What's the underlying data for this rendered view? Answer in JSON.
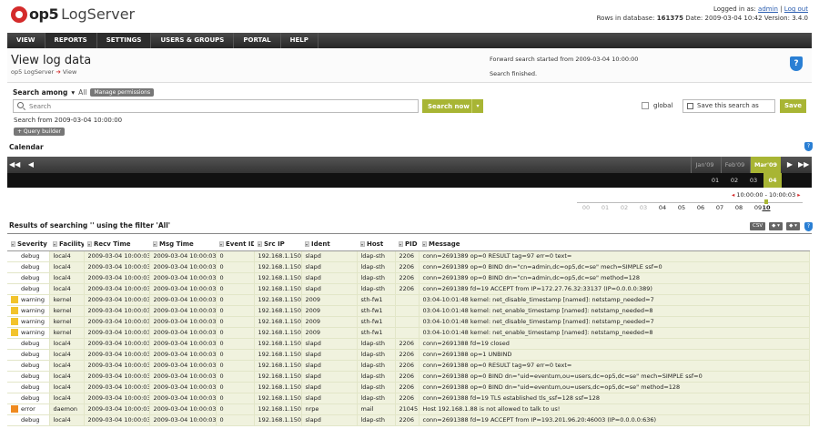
{
  "header": {
    "brand": "op5",
    "product": "LogServer",
    "logged_in_label": "Logged in as:",
    "user": "admin",
    "separator": "|",
    "logout": "Log out",
    "rows_label": "Rows in database:",
    "rows_value": "161375",
    "date_label": "Date:",
    "date_value": "2009-03-04 10:42",
    "version_label": "Version:",
    "version_value": "3.4.0"
  },
  "nav": [
    "VIEW",
    "REPORTS",
    "SETTINGS",
    "USERS & GROUPS",
    "PORTAL",
    "HELP"
  ],
  "page": {
    "title": "View log data",
    "crumb_root": "op5 LogServer",
    "crumb_arrow": "➔",
    "crumb_leaf": "View",
    "status_lines": [
      "Forward search started from 2009-03-04 10:00:00",
      "Search finished."
    ],
    "help_glyph": "?"
  },
  "search": {
    "among_label": "Search among",
    "among_caret": "▾",
    "among_value": "All",
    "manage_permissions": "Manage permissions",
    "placeholder": "Search",
    "search_now": "Search now",
    "dropdown_caret": "▾",
    "from_text": "Search from 2009-03-04 10:00:00",
    "query_builder": "+ Query builder",
    "global_label": "global",
    "save_as_label": "Save this search as",
    "save_button": "Save"
  },
  "calendar": {
    "title": "Calendar",
    "help_glyph": "?",
    "nav_first": "◀◀",
    "nav_prev": "◀",
    "nav_next": "▶",
    "nav_last": "▶▶",
    "months": [
      "Jan'09",
      "Feb'09",
      "Mar'09"
    ],
    "selected_month": "Mar'09",
    "days": [
      "01",
      "02",
      "03",
      "04"
    ],
    "selected_day": "04",
    "time_range": "10:00:00 - 10:00:03",
    "range_marker_left": "◂",
    "range_marker_right": "▸",
    "hours": [
      "00",
      "01",
      "02",
      "03",
      "04",
      "05",
      "06",
      "07",
      "08",
      "09",
      "10"
    ],
    "current_hour": "10"
  },
  "results": {
    "title": "Results of searching '' using the filter 'All'",
    "csv": "CSV",
    "btn1": "◆ ▾",
    "btn2": "◆ ▾",
    "help_glyph": "?",
    "sort_glyph": "▾",
    "columns": [
      "Severity",
      "Facility",
      "Recv Time",
      "Msg Time",
      "Event ID",
      "Src IP",
      "Ident",
      "Host",
      "PID",
      "Message"
    ],
    "severity_colors": {
      "debug": "",
      "warning": "#f2c32b",
      "error": "#ef8a1f"
    },
    "rows": [
      [
        "debug",
        "local4",
        "2009-03-04 10:00:03",
        "2009-03-04 10:00:03",
        "0",
        "192.168.1.150",
        "slapd",
        "ldap-sth",
        "2206",
        "conn=2691389 op=0 RESULT tag=97 err=0 text="
      ],
      [
        "debug",
        "local4",
        "2009-03-04 10:00:03",
        "2009-03-04 10:00:03",
        "0",
        "192.168.1.150",
        "slapd",
        "ldap-sth",
        "2206",
        "conn=2691389 op=0 BIND dn=\"cn=admin,dc=op5,dc=se\" mech=SIMPLE ssf=0"
      ],
      [
        "debug",
        "local4",
        "2009-03-04 10:00:03",
        "2009-03-04 10:00:03",
        "0",
        "192.168.1.150",
        "slapd",
        "ldap-sth",
        "2206",
        "conn=2691389 op=0 BIND dn=\"cn=admin,dc=op5,dc=se\" method=128"
      ],
      [
        "debug",
        "local4",
        "2009-03-04 10:00:03",
        "2009-03-04 10:00:03",
        "0",
        "192.168.1.150",
        "slapd",
        "ldap-sth",
        "2206",
        "conn=2691389 fd=19 ACCEPT from IP=172.27.76.32:33137 (IP=0.0.0.0:389)"
      ],
      [
        "warning",
        "kernel",
        "2009-03-04 10:00:03",
        "2009-03-04 10:00:03",
        "0",
        "192.168.1.150",
        "2009",
        "sth-fw1",
        "",
        "03:04-10:01:48 kernel: net_disable_timestamp [named]: netstamp_needed=7"
      ],
      [
        "warning",
        "kernel",
        "2009-03-04 10:00:03",
        "2009-03-04 10:00:03",
        "0",
        "192.168.1.150",
        "2009",
        "sth-fw1",
        "",
        "03:04-10:01:48 kernel: net_enable_timestamp [named]: netstamp_needed=8"
      ],
      [
        "warning",
        "kernel",
        "2009-03-04 10:00:03",
        "2009-03-04 10:00:03",
        "0",
        "192.168.1.150",
        "2009",
        "sth-fw1",
        "",
        "03:04-10:01:48 kernel: net_disable_timestamp [named]: netstamp_needed=7"
      ],
      [
        "warning",
        "kernel",
        "2009-03-04 10:00:03",
        "2009-03-04 10:00:03",
        "0",
        "192.168.1.150",
        "2009",
        "sth-fw1",
        "",
        "03:04-10:01:48 kernel: net_enable_timestamp [named]: netstamp_needed=8"
      ],
      [
        "debug",
        "local4",
        "2009-03-04 10:00:03",
        "2009-03-04 10:00:03",
        "0",
        "192.168.1.150",
        "slapd",
        "ldap-sth",
        "2206",
        "conn=2691388 fd=19 closed"
      ],
      [
        "debug",
        "local4",
        "2009-03-04 10:00:03",
        "2009-03-04 10:00:03",
        "0",
        "192.168.1.150",
        "slapd",
        "ldap-sth",
        "2206",
        "conn=2691388 op=1 UNBIND"
      ],
      [
        "debug",
        "local4",
        "2009-03-04 10:00:03",
        "2009-03-04 10:00:03",
        "0",
        "192.168.1.150",
        "slapd",
        "ldap-sth",
        "2206",
        "conn=2691388 op=0 RESULT tag=97 err=0 text="
      ],
      [
        "debug",
        "local4",
        "2009-03-04 10:00:03",
        "2009-03-04 10:00:03",
        "0",
        "192.168.1.150",
        "slapd",
        "ldap-sth",
        "2206",
        "conn=2691388 op=0 BIND dn=\"uid=eventum,ou=users,dc=op5,dc=se\" mech=SIMPLE ssf=0"
      ],
      [
        "debug",
        "local4",
        "2009-03-04 10:00:03",
        "2009-03-04 10:00:03",
        "0",
        "192.168.1.150",
        "slapd",
        "ldap-sth",
        "2206",
        "conn=2691388 op=0 BIND dn=\"uid=eventum,ou=users,dc=op5,dc=se\" method=128"
      ],
      [
        "debug",
        "local4",
        "2009-03-04 10:00:03",
        "2009-03-04 10:00:03",
        "0",
        "192.168.1.150",
        "slapd",
        "ldap-sth",
        "2206",
        "conn=2691388 fd=19 TLS established tls_ssf=128 ssf=128"
      ],
      [
        "error",
        "daemon",
        "2009-03-04 10:00:03",
        "2009-03-04 10:00:03",
        "0",
        "192.168.1.150",
        "nrpe",
        "mail",
        "21045",
        "Host 192.168.1.88 is not allowed to talk to us!"
      ],
      [
        "debug",
        "local4",
        "2009-03-04 10:00:03",
        "2009-03-04 10:00:03",
        "0",
        "192.168.1.150",
        "slapd",
        "ldap-sth",
        "2206",
        "conn=2691388 fd=19 ACCEPT from IP=193.201.96.20:46003 (IP=0.0.0.0:636)"
      ]
    ]
  }
}
